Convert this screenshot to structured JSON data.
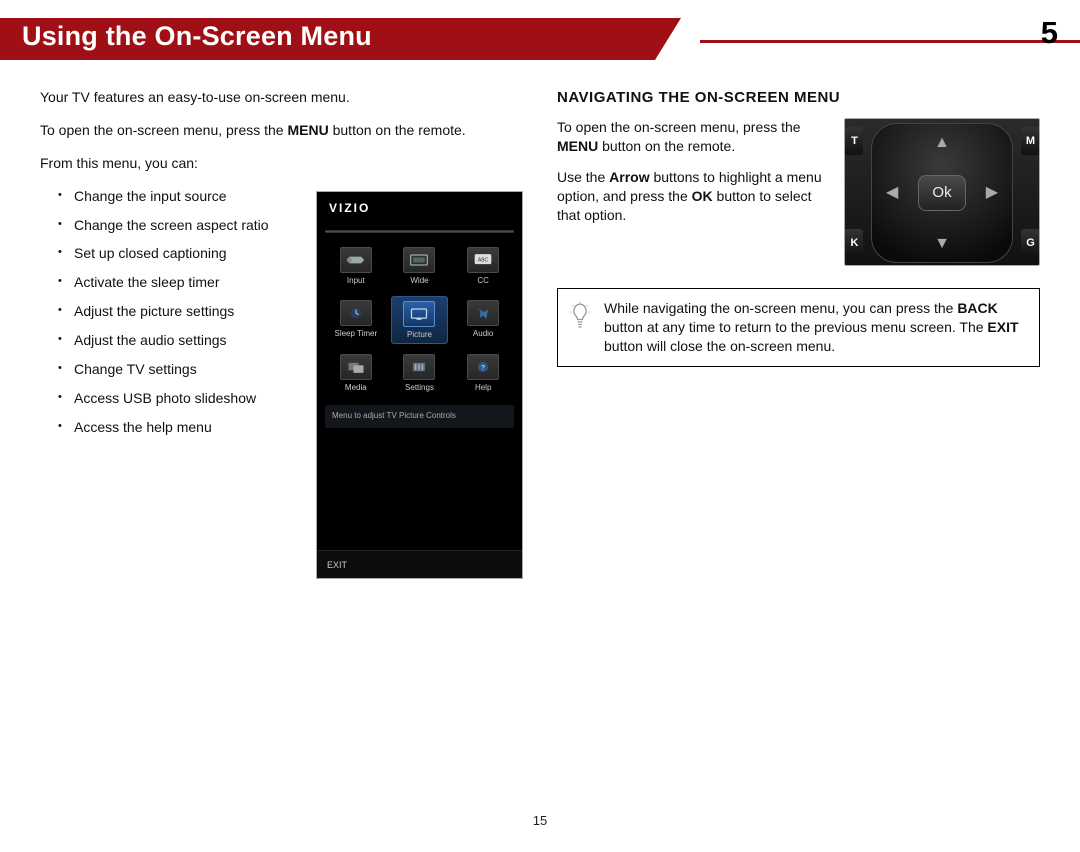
{
  "header": {
    "title": "Using the On-Screen Menu",
    "chapter": "5"
  },
  "left": {
    "p1": "Your TV features an easy-to-use on-screen menu.",
    "p2a": "To open the on-screen menu, press the ",
    "p2b": "MENU",
    "p2c": " button on the remote.",
    "p3": "From this menu, you can:",
    "bullets": [
      "Change the input source",
      "Change the screen aspect ratio",
      "Set up closed captioning",
      "Activate the sleep timer",
      "Adjust the picture settings",
      "Adjust the audio settings",
      "Change TV settings",
      "Access USB photo slideshow",
      "Access the help menu"
    ]
  },
  "phone": {
    "brand": "VIZIO",
    "tiles": [
      {
        "label": "Input"
      },
      {
        "label": "Wide"
      },
      {
        "label": "CC",
        "badge": "ABC"
      },
      {
        "label": "Sleep Timer"
      },
      {
        "label": "Picture",
        "highlight": true
      },
      {
        "label": "Audio"
      },
      {
        "label": "Media"
      },
      {
        "label": "Settings"
      },
      {
        "label": "Help"
      }
    ],
    "hint": "Menu to adjust TV Picture Controls",
    "exit": "EXIT"
  },
  "right": {
    "heading": "NAVIGATING THE ON-SCREEN MENU",
    "p1a": "To open the on-screen menu, press the ",
    "p1b": "MENU",
    "p1c": " button on the remote.",
    "p2a": "Use the ",
    "p2b": "Arrow",
    "p2c": " buttons to highlight a menu option, and press the ",
    "p2d": "OK",
    "p2e": " button to select that option.",
    "remote": {
      "tl": "T",
      "tr": "M",
      "bl": "K",
      "br": "G",
      "ok": "Ok"
    },
    "tip": {
      "t1": "While navigating the on-screen menu, you can press the ",
      "t2": "BACK",
      "t3": " button at any time to return to the previous menu screen. The ",
      "t4": "EXIT",
      "t5": " button will close the on-screen menu."
    }
  },
  "page_no": "15"
}
